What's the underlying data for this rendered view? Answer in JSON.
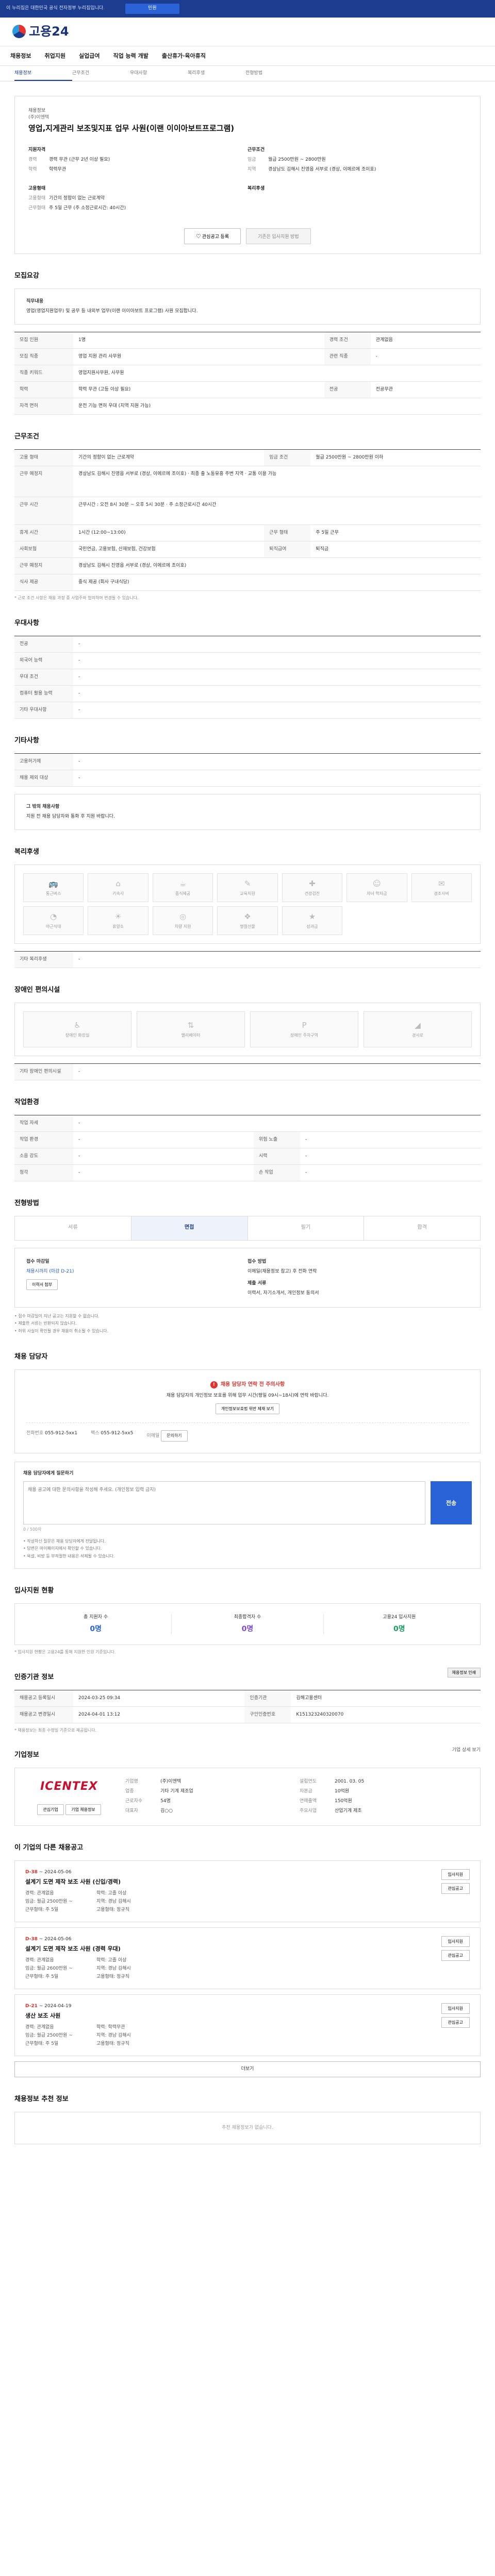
{
  "topbar": {
    "notice": "이 누리집은 대한민국 공식 전자정부 누리집입니다.",
    "button": "민원"
  },
  "logo": {
    "text": "고용24"
  },
  "gnb": [
    "채용정보",
    "취업지원",
    "실업급여",
    "직업 능력 개발",
    "출산휴가·육아휴직"
  ],
  "subnav": [
    "채용정보",
    "근무조건",
    "우대사항",
    "복리후생",
    "전형방법"
  ],
  "head": {
    "label": "채용정보",
    "company": "(주)이엔텍",
    "job": "영업,지게관리 보조및지표 업무 사원(이랜 이이아보트프로그램)",
    "recruit_title": "지원자격",
    "recruit": [
      {
        "k": "경력",
        "v": "경력 무관 (근무 2년 이상 필요)"
      },
      {
        "k": "학력",
        "v": "학력무관"
      }
    ],
    "cond_title": "근무조건",
    "cond": [
      {
        "k": "임금",
        "v": "월급 2500만원 ~ 2800만원"
      },
      {
        "k": "지역",
        "v": "경상남도 김해시 진영읍 서부로 (경상, 이에르에 조이호)"
      }
    ],
    "form_title": "고용형태",
    "form": [
      {
        "k": "고용형태",
        "v": "기간의 정함이 없는 근로계약"
      },
      {
        "k": "근무형태",
        "v": "주 5일 근무 (주 소정근로시간: 40시간)"
      }
    ],
    "welfare_title": "복리후생",
    "btn_interest": "관심공고 등록",
    "btn_apply": "기존은 입사지원 방법"
  },
  "recruit_sec": {
    "title": "모집요강",
    "duty_label": "직무내용",
    "duty": "영업(영업지원업무) 및 공무 등 내외부 업무(이랜 이이아보트 프로그램) 사원 모집합니다.",
    "rows": [
      {
        "k": "모집 인원",
        "v": "1명",
        "k2": "경력 조건",
        "v2": "관계없음"
      },
      {
        "k": "모집 직종",
        "v": "영업 지원 관리 사무원",
        "k2": "관련 직종",
        "v2": "-"
      },
      {
        "k": "직종 키워드",
        "v": "영업지원사무원, 사무원",
        "k2": "",
        "v2": ""
      },
      {
        "k": "학력",
        "v": "학력 무관 (고등 이상 필요)",
        "k2": "전공",
        "v2": "전공무관"
      },
      {
        "k": "자격 면허",
        "v": "운전 기능 면허 우대 (지역 지원 가능)",
        "k2": "",
        "v2": ""
      }
    ]
  },
  "cond_sec": {
    "title": "근무조건",
    "rows": [
      {
        "k": "고용 형태",
        "v": "기간의 정함이 없는 근로계약",
        "k2": "임금 조건",
        "v2": "월급 2500만원 ~ 2800만원 이하"
      },
      {
        "k": "근무 예정지",
        "v": "경상남도 김해시 진영읍 서부로 (경상, 이에르에 조이호) · 최종 출 노동유흥 주변 지역 · 교통 이용 가능",
        "k2": "",
        "v2": ""
      },
      {
        "k": "근무 시간",
        "v": "근무시간 : 오전 8시 30분 ~ 오후 5시 30분 · 주 소정근로시간 40시간",
        "k2": "",
        "v2": ""
      },
      {
        "k": "휴게 시간",
        "v": "1시간 (12:00~13:00)",
        "k2": "근무 형태",
        "v2": "주 5일 근무"
      },
      {
        "k": "사회보험",
        "v": "국민연금, 고용보험, 산재보험, 건강보험",
        "k2": "퇴직급여",
        "v2": "퇴직금"
      },
      {
        "k": "근무 예정지",
        "v": "경상남도 김해시 진영읍 서부로 (경상, 이에르에 조이호)",
        "k2": "",
        "v2": ""
      },
      {
        "k": "식사 제공",
        "v": "중식 제공 (회사 구내식당)",
        "k2": "",
        "v2": ""
      }
    ],
    "note": "* 근로 조건 사항은 채용 과정 중 사업주와 협의하여 변경될 수 있습니다."
  },
  "pref_sec": {
    "title": "우대사항",
    "rows": [
      {
        "k": "전공",
        "v": "-"
      },
      {
        "k": "외국어 능력",
        "v": "-"
      },
      {
        "k": "우대 조건",
        "v": "-"
      },
      {
        "k": "컴퓨터 활용 능력",
        "v": "-"
      },
      {
        "k": "기타 우대사항",
        "v": "-"
      }
    ]
  },
  "etc_sec": {
    "title": "기타사항",
    "rows": [
      {
        "k": "고용허가제",
        "v": "-"
      },
      {
        "k": "채용 제외 대상",
        "v": "-"
      }
    ],
    "extra_label": "그 밖의 채용사항",
    "extra": "지원 전 채용 담당자와 통화 후 지원 바랍니다."
  },
  "welfare_sec": {
    "title": "복리후생",
    "items": [
      "통근버스",
      "기숙사",
      "중식제공",
      "교육지원",
      "건강검진",
      "자녀 학자금",
      "경조사비",
      "야근식대",
      "휴양소",
      "차량 지원",
      "명절선물",
      "성과급"
    ],
    "other_label": "기타 복리후생",
    "other": "-"
  },
  "disabled_sec": {
    "title": "장애인 편의시설",
    "items": [
      "장애인 화장실",
      "엘리베이터",
      "장애인 주차구역",
      "경사로"
    ],
    "other_label": "기타 장애인 편의시설",
    "other": "-"
  },
  "work_sec": {
    "title": "작업환경",
    "rows": [
      {
        "k": "작업 자세",
        "v": "-",
        "k2": "",
        "v2": ""
      },
      {
        "k": "작업 환경",
        "v": "-",
        "k2": "위험 노출",
        "v2": "-"
      },
      {
        "k": "소음 강도",
        "v": "-",
        "k2": "시력",
        "v2": "-"
      },
      {
        "k": "청각",
        "v": "-",
        "k2": "손 작업",
        "v2": "-"
      }
    ]
  },
  "process_sec": {
    "title": "전형방법",
    "steps": [
      "서류",
      "면접",
      "필기",
      "합격"
    ]
  },
  "apply_sec": {
    "method_title": "접수 마감일",
    "deadline": "채용시까지 (마감 D-21)",
    "method_btn": "이력서 첨부",
    "doc_title": "접수 방법",
    "doc": "이메일(채용정보 참고) 후 전화 연락",
    "paper_title": "제출 서류",
    "paper": "이력서, 자기소개서, 개인정보 동의서",
    "notes": [
      "접수 마감일이 지난 공고는 지원할 수 없습니다.",
      "제출한 서류는 반환되지 않습니다.",
      "허위 사실이 확인될 경우 채용이 취소될 수 있습니다."
    ]
  },
  "contact_sec": {
    "title": "채용 담당자",
    "warn": "채용 담당자 연락 전 주의사항",
    "desc": "채용 담당자의 개인정보 보호를 위해 업무 시간(평일 09시~18시)에 연락 바랍니다.",
    "btn": "개인정보보호법 위반 제재 보기",
    "phone_k": "전화번호",
    "phone": "055-912-5xx1",
    "fax_k": "팩스",
    "fax": "055-912-5xx5",
    "mail_k": "이메일",
    "mail": "문의하기"
  },
  "ask_sec": {
    "title": "채용 담당자에게 질문하기",
    "placeholder": "채용 공고에 대한 문의사항을 작성해 주세요. (개인정보 입력 금지)",
    "counter": "0 / 500자",
    "send": "전송",
    "bullets": [
      "작성하신 질문은 채용 담당자에게 전달됩니다.",
      "답변은 마이페이지에서 확인할 수 있습니다.",
      "욕설, 비방 등 부적절한 내용은 삭제될 수 있습니다."
    ]
  },
  "stat_sec": {
    "title": "입사지원 현황",
    "items": [
      {
        "lbl": "총 지원자 수",
        "num": "0명"
      },
      {
        "lbl": "최종합격자 수",
        "num": "0명"
      },
      {
        "lbl": "고용24 입사지원",
        "num": "0명"
      }
    ],
    "note": "* 입사지원 현황은 고용24를 통해 지원한 인원 기준입니다."
  },
  "info_sec": {
    "title": "인증기관 정보",
    "print": "채용정보 인쇄",
    "rows": [
      {
        "k": "채용공고 등록일시",
        "v": "2024-03-25 09:34",
        "k2": "인증기관",
        "v2": "김해고용센터"
      },
      {
        "k": "채용공고 변경일시",
        "v": "2024-04-01 13:12",
        "k2": "구인인증번호",
        "v2": "K151323240320070"
      }
    ],
    "note": "* 채용정보는 최종 수정일 기준으로 제공됩니다."
  },
  "company_sec": {
    "title": "기업정보",
    "more": "기업 상세 보기",
    "brand": "ICENTEX",
    "fields": [
      {
        "k": "기업명",
        "v": "(주)이엔텍"
      },
      {
        "k": "업종",
        "v": "기타 기계 제조업"
      },
      {
        "k": "설립연도",
        "v": "2001. 03. 05"
      },
      {
        "k": "자본금",
        "v": "10억원"
      },
      {
        "k": "근로자수",
        "v": "54명"
      },
      {
        "k": "연매출액",
        "v": "150억원"
      },
      {
        "k": "대표자",
        "v": "김○○"
      },
      {
        "k": "주요사업",
        "v": "산업기계 제조"
      }
    ],
    "btn1": "관심기업",
    "btn2": "기업 채용정보"
  },
  "other_jobs": {
    "title": "이 기업의 다른 채용공고",
    "jobs": [
      {
        "dday": "D-38",
        "date": "~ 2024-05-06",
        "title": "설계기 도면 제작 보조 사원 (신입/경력)",
        "meta": [
          "경력: 관계없음",
          "학력: 고졸 이상",
          "임금: 월급 2500만원 ~",
          "지역: 경남 김해시",
          "근무형태: 주 5일",
          "고용형태: 정규직"
        ],
        "btn1": "입사지원",
        "btn2": "관심공고"
      },
      {
        "dday": "D-38",
        "date": "~ 2024-05-06",
        "title": "설계기 도면 제작 보조 사원 (경력 우대)",
        "meta": [
          "경력: 관계없음",
          "학력: 고졸 이상",
          "임금: 월급 2600만원 ~",
          "지역: 경남 김해시",
          "근무형태: 주 5일",
          "고용형태: 정규직"
        ],
        "btn1": "입사지원",
        "btn2": "관심공고"
      },
      {
        "dday": "D-21",
        "date": "~ 2024-04-19",
        "title": "생산 보조 사원",
        "meta": [
          "경력: 관계없음",
          "학력: 학력무관",
          "임금: 월급 2500만원 ~",
          "지역: 경남 김해시",
          "근무형태: 주 5일",
          "고용형태: 정규직"
        ],
        "btn1": "입사지원",
        "btn2": "관심공고"
      }
    ],
    "more": "더보기"
  },
  "recent_sec": {
    "title": "채용정보 추천 정보",
    "empty": "추천 채용정보가 없습니다."
  }
}
